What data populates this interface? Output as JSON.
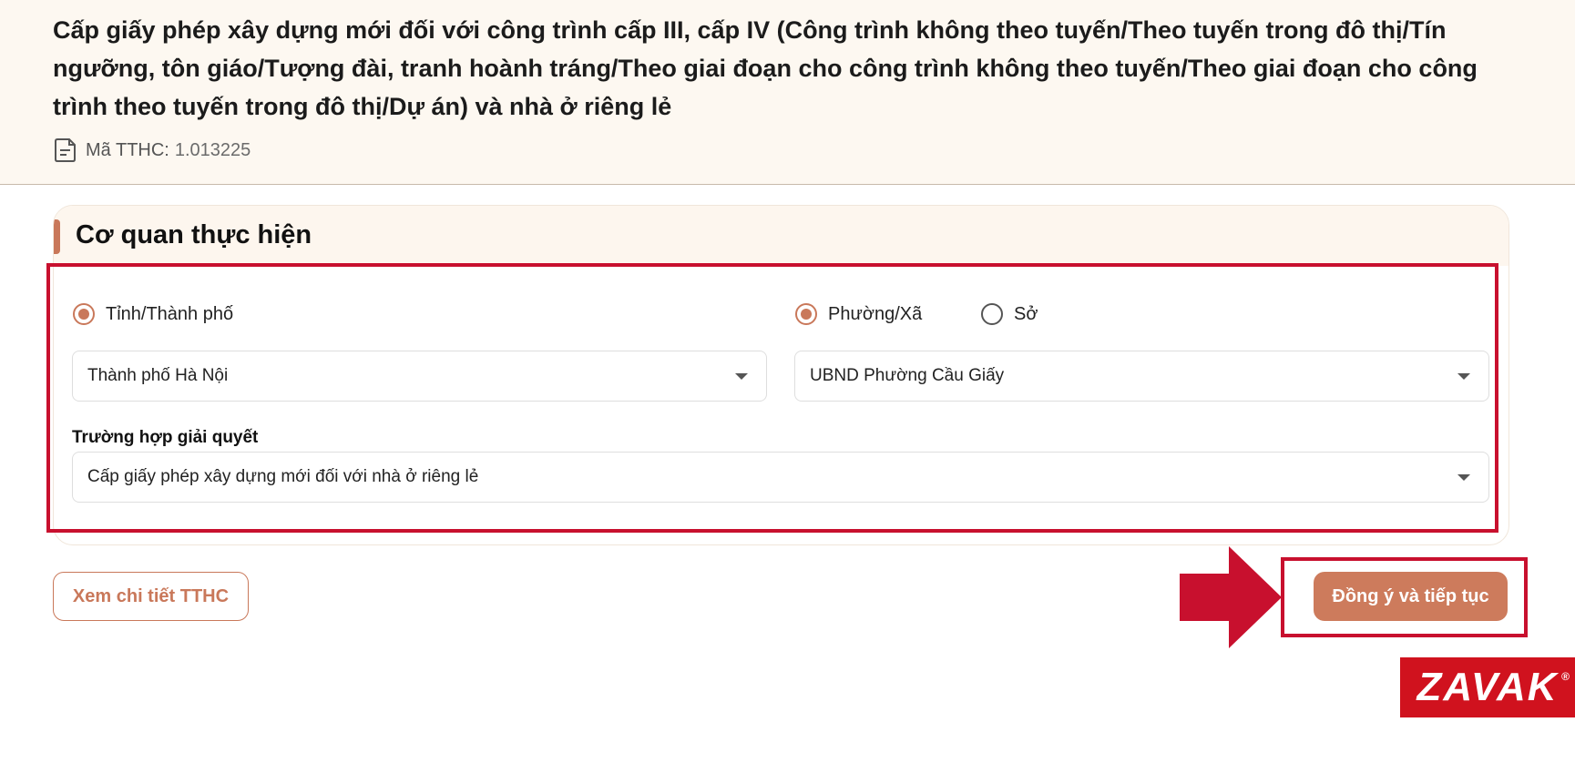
{
  "procedure": {
    "title": "Cấp giấy phép xây dựng mới đối với công trình cấp III, cấp IV (Công trình không theo tuyến/Theo tuyến trong đô thị/Tín ngưỡng, tôn giáo/Tượng đài, tranh hoành tráng/Theo giai đoạn cho công trình không theo tuyến/Theo giai đoạn cho công trình theo tuyến trong đô thị/Dự án) và nhà ở riêng lẻ",
    "code_label": "Mã TTHC:",
    "code_value": "1.013225",
    "code_icon": "document-icon"
  },
  "agency_section": {
    "title": "Cơ quan thực hiện",
    "province_radio": {
      "label": "Tỉnh/Thành phố",
      "selected": true
    },
    "ward_radio": {
      "label": "Phường/Xã",
      "selected": true
    },
    "department_radio": {
      "label": "Sở",
      "selected": false
    },
    "province_select": {
      "value": "Thành phố Hà Nội"
    },
    "agency_select": {
      "value": "UBND Phường Cầu Giấy"
    },
    "case_label": "Trường hợp giải quyết",
    "case_select": {
      "value": "Cấp giấy phép xây dựng mới đối với nhà ở riêng lẻ"
    }
  },
  "actions": {
    "details_button": "Xem chi tiết TTHC",
    "continue_button": "Đồng ý và tiếp tục"
  },
  "watermark": {
    "text": "ZAVAK",
    "mark": "®"
  },
  "colors": {
    "accent": "#cd7b5c",
    "header_bg": "#fdf8f1",
    "highlight": "#c8102e",
    "logo_bg": "#d0121e"
  }
}
